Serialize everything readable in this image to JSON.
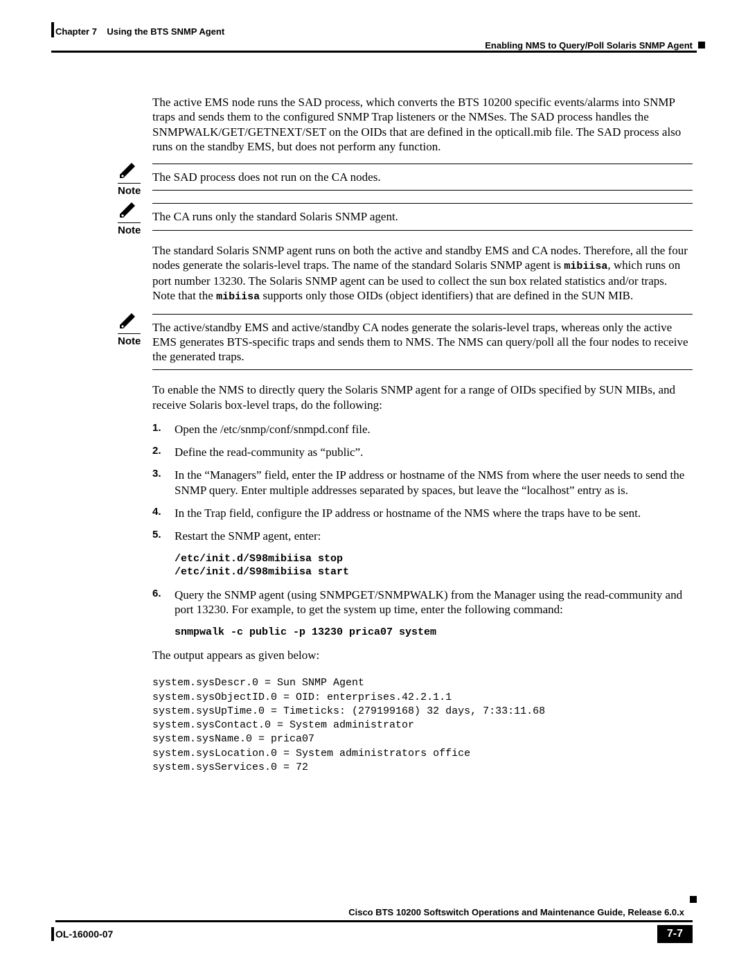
{
  "header": {
    "chapter_label": "Chapter 7",
    "chapter_title": "Using the BTS SNMP Agent",
    "section_title": "Enabling NMS to Query/Poll Solaris SNMP Agent"
  },
  "paragraphs": {
    "intro": "The active EMS node runs the SAD process, which converts the BTS 10200 specific events/alarms into SNMP traps and sends them to the configured SNMP Trap listeners or the NMSes. The SAD process handles the SNMPWALK/GET/GETNEXT/SET on the OIDs that are defined in the opticall.mib file. The SAD process also runs on the standby EMS, but does not perform any function.",
    "after_notes_1a": "The standard Solaris SNMP agent runs on both the active and standby EMS and CA nodes. Therefore, all the four nodes generate the solaris-level traps. The name of the standard Solaris SNMP agent is ",
    "after_notes_1b": ", which runs on port number 13230. The Solaris SNMP agent can be used to collect the sun box related statistics and/or traps. Note that the ",
    "after_notes_1c": " supports only those OIDs (object identifiers) that are defined in the SUN MIB.",
    "mibiisa": "mibiisa",
    "enable_intro": "To enable the NMS to directly query the Solaris SNMP agent for a range of OIDs specified by SUN MIBs, and receive Solaris box-level traps, do the following:",
    "output_intro": "The output appears as given below:"
  },
  "notes": {
    "label": "Note",
    "n1": "The SAD process does not run on the CA nodes.",
    "n2": "The CA runs only the standard Solaris SNMP agent.",
    "n3": "The active/standby EMS and active/standby CA nodes generate the solaris-level traps, whereas only the active EMS generates BTS-specific traps and sends them to NMS. The NMS can query/poll all the four nodes to receive the generated traps."
  },
  "steps": {
    "s1": "Open the /etc/snmp/conf/snmpd.conf file.",
    "s2": "Define the read-community as “public”.",
    "s3": "In the “Managers” field, enter the IP address or hostname of the NMS from where the user needs to send the SNMP query. Enter multiple addresses separated by spaces, but leave the “localhost” entry as is.",
    "s4": "In the Trap field, configure the IP address or hostname of the NMS where the traps have to be sent.",
    "s5": "Restart the SNMP agent, enter:",
    "s6": "Query the SNMP agent (using SNMPGET/SNMPWALK) from the Manager using the read-community and port 13230. For example, to get the system up time, enter the following command:"
  },
  "commands": {
    "restart": "/etc/init.d/S98mibiisa stop\n/etc/init.d/S98mibiisa start",
    "snmpwalk": "snmpwalk -c public -p 13230 prica07 system"
  },
  "output": "system.sysDescr.0 = Sun SNMP Agent\nsystem.sysObjectID.0 = OID: enterprises.42.2.1.1\nsystem.sysUpTime.0 = Timeticks: (279199168) 32 days, 7:33:11.68\nsystem.sysContact.0 = System administrator\nsystem.sysName.0 = prica07\nsystem.sysLocation.0 = System administrators office\nsystem.sysServices.0 = 72",
  "footer": {
    "guide_title": "Cisco BTS 10200 Softswitch Operations and Maintenance Guide, Release 6.0.x",
    "doc_id": "OL-16000-07",
    "page_num": "7-7"
  }
}
